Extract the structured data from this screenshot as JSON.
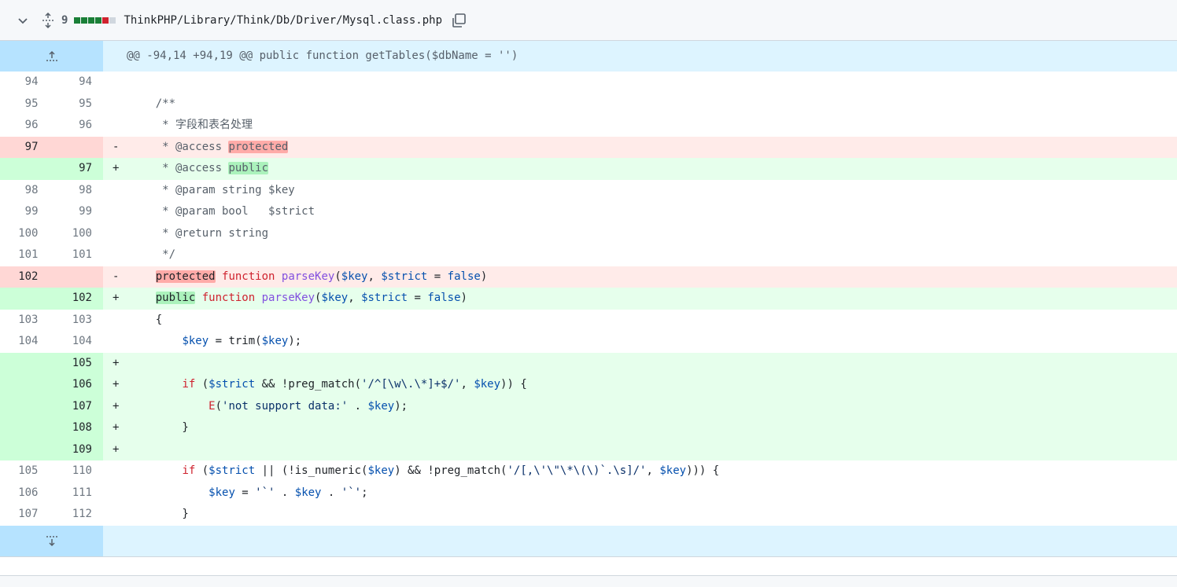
{
  "header": {
    "changes_count": "9",
    "file_path": "ThinkPHP/Library/Think/Db/Driver/Mysql.class.php",
    "diffstat": [
      "#1a7f37",
      "#1a7f37",
      "#1a7f37",
      "#1a7f37",
      "#cf222e",
      "#d0d7de"
    ],
    "icons": {
      "collapse": "chevron-down-icon",
      "expand": "unfold-icon",
      "copy": "copy-icon"
    }
  },
  "hunk_header": "@@ -94,14 +94,19 @@ public function getTables($dbName = '')",
  "rows": [
    {
      "type": "ctx",
      "old": "94",
      "new": "94",
      "sign": " ",
      "code": ""
    },
    {
      "type": "ctx",
      "old": "95",
      "new": "95",
      "sign": " ",
      "code": "    /**"
    },
    {
      "type": "ctx",
      "old": "96",
      "new": "96",
      "sign": " ",
      "code": "     * 字段和表名处理"
    },
    {
      "type": "del",
      "old": "97",
      "new": "",
      "sign": "-",
      "code": "     * @access protected"
    },
    {
      "type": "add",
      "old": "",
      "new": "97",
      "sign": "+",
      "code": "     * @access public"
    },
    {
      "type": "ctx",
      "old": "98",
      "new": "98",
      "sign": " ",
      "code": "     * @param string $key"
    },
    {
      "type": "ctx",
      "old": "99",
      "new": "99",
      "sign": " ",
      "code": "     * @param bool   $strict"
    },
    {
      "type": "ctx",
      "old": "100",
      "new": "100",
      "sign": " ",
      "code": "     * @return string"
    },
    {
      "type": "ctx",
      "old": "101",
      "new": "101",
      "sign": " ",
      "code": "     */"
    },
    {
      "type": "del",
      "old": "102",
      "new": "",
      "sign": "-",
      "code": "    protected function parseKey($key, $strict = false)"
    },
    {
      "type": "add",
      "old": "",
      "new": "102",
      "sign": "+",
      "code": "    public function parseKey($key, $strict = false)"
    },
    {
      "type": "ctx",
      "old": "103",
      "new": "103",
      "sign": " ",
      "code": "    {"
    },
    {
      "type": "ctx",
      "old": "104",
      "new": "104",
      "sign": " ",
      "code": "        $key = trim($key);"
    },
    {
      "type": "add",
      "old": "",
      "new": "105",
      "sign": "+",
      "code": ""
    },
    {
      "type": "add",
      "old": "",
      "new": "106",
      "sign": "+",
      "code": "        if ($strict && !preg_match('/^[\\w\\.\\*]+$/', $key)) {"
    },
    {
      "type": "add",
      "old": "",
      "new": "107",
      "sign": "+",
      "code": "            E('not support data:' . $key);"
    },
    {
      "type": "add",
      "old": "",
      "new": "108",
      "sign": "+",
      "code": "        }"
    },
    {
      "type": "add",
      "old": "",
      "new": "109",
      "sign": "+",
      "code": ""
    },
    {
      "type": "ctx",
      "old": "105",
      "new": "110",
      "sign": " ",
      "code": "        if ($strict || (!is_numeric($key) && !preg_match('/[,\\'\\\"\\*\\(\\)`.\\s]/', $key))) {"
    },
    {
      "type": "ctx",
      "old": "106",
      "new": "111",
      "sign": " ",
      "code": "            $key = '`' . $key . '`';"
    },
    {
      "type": "ctx",
      "old": "107",
      "new": "112",
      "sign": " ",
      "code": "        }"
    }
  ]
}
